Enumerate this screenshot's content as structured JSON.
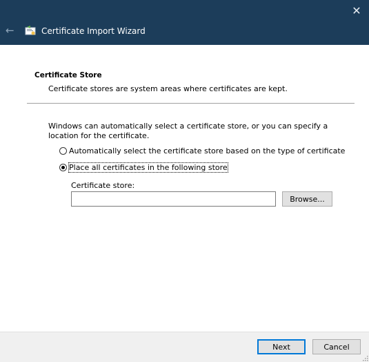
{
  "window": {
    "title": "Certificate Import Wizard",
    "close_glyph": "✕",
    "back_glyph": "←"
  },
  "section": {
    "title": "Certificate Store",
    "description": "Certificate stores are system areas where certificates are kept."
  },
  "intro_text": "Windows can automatically select a certificate store, or you can specify a location for the certificate.",
  "options": {
    "auto_label": "Automatically select the certificate store based on the type of certificate",
    "place_label": "Place all certificates in the following store"
  },
  "store": {
    "label": "Certificate store:",
    "value": "",
    "browse_label": "Browse..."
  },
  "buttons": {
    "next_label": "Next",
    "cancel_label": "Cancel"
  },
  "colors": {
    "titlebar": "#1c3d5a",
    "accent": "#0078d7"
  }
}
